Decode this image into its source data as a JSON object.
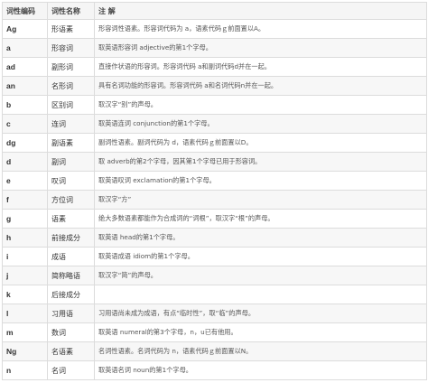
{
  "header": {
    "col_code": "词性编码",
    "col_name": "词性名称",
    "col_desc": "注 解"
  },
  "rows": [
    {
      "code": "Ag",
      "name": "形语素",
      "desc": "形容词性语素。形容词代码为 a，语素代码ｇ前面置以A。"
    },
    {
      "code": "a",
      "name": "形容词",
      "desc": "取英语形容词 adjective的第1个字母。"
    },
    {
      "code": "ad",
      "name": "副形词",
      "desc": "直接作状语的形容词。形容词代码 a和副词代码d并在一起。"
    },
    {
      "code": "an",
      "name": "名形词",
      "desc": "具有名词功能的形容词。形容词代码 a和名词代码n并在一起。"
    },
    {
      "code": "b",
      "name": "区别词",
      "desc": "取汉字“别”的声母。"
    },
    {
      "code": "c",
      "name": "连词",
      "desc": "取英语连词 conjunction的第1个字母。"
    },
    {
      "code": "dg",
      "name": "副语素",
      "desc": "副词性语素。副词代码为 d，语素代码ｇ前面置以D。"
    },
    {
      "code": "d",
      "name": "副词",
      "desc": "取 adverb的第2个字母，因其第1个字母已用于形容词。"
    },
    {
      "code": "e",
      "name": "叹词",
      "desc": "取英语叹词 exclamation的第1个字母。"
    },
    {
      "code": "f",
      "name": "方位词",
      "desc": "取汉字“方”"
    },
    {
      "code": "g",
      "name": "语素",
      "desc": "绝大多数语素都能作为合成词的“词根”，取汉字“根”的声母。"
    },
    {
      "code": "h",
      "name": "前接成分",
      "desc": "取英语 head的第1个字母。"
    },
    {
      "code": "i",
      "name": "成语",
      "desc": "取英语成语 idiom的第1个字母。"
    },
    {
      "code": "j",
      "name": "简称略语",
      "desc": "取汉字“简”的声母。"
    },
    {
      "code": "k",
      "name": "后接成分",
      "desc": ""
    },
    {
      "code": "l",
      "name": "习用语",
      "desc": "习用语尚未成为成语，有点“临时性”，取“临”的声母。"
    },
    {
      "code": "m",
      "name": "数词",
      "desc": "取英语 numeral的第3个字母，n，u已有他用。"
    },
    {
      "code": "Ng",
      "name": "名语素",
      "desc": "名词性语素。名词代码为 n，语素代码ｇ前面置以N。"
    },
    {
      "code": "n",
      "name": "名词",
      "desc": "取英语名词 noun的第1个字母。"
    }
  ]
}
